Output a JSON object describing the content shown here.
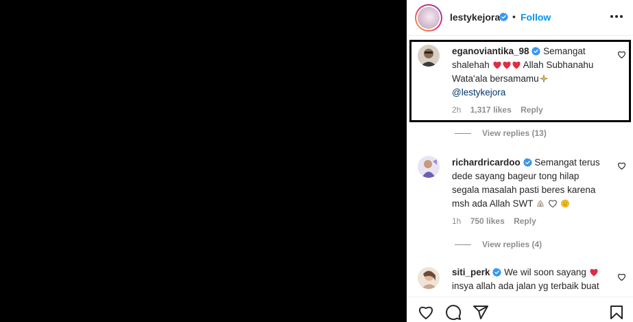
{
  "header": {
    "username": "lestykejora",
    "separator": "•",
    "follow_label": "Follow"
  },
  "comments": [
    {
      "username": "eganoviantika_98",
      "text_part1": " Semangat shalehah",
      "text_part2": " Allah Subhanahu Wata'ala bersamamu",
      "mention": "@lestykejora",
      "time": "2h",
      "likes": "1,317 likes",
      "reply_label": "Reply",
      "view_replies": "View replies (13)"
    },
    {
      "username": "richardricardoo",
      "text": " Semangat terus dede sayang bageur tong hilap segala masalah pasti beres karena msh ada Allah SWT ",
      "time": "1h",
      "likes": "750 likes",
      "reply_label": "Reply",
      "view_replies": "View replies (4)"
    },
    {
      "username": "siti_perk",
      "text": " We wil soon sayang",
      "text_part2": "insya allah ada jalan yg terbaik buat"
    }
  ],
  "colors": {
    "accent": "#0095f6",
    "verified": "#3897f0",
    "heart_red": "#ed4956",
    "text": "#262626",
    "muted": "#8e8e8e",
    "mention": "#00376b"
  },
  "icons": {
    "like": "heart-icon",
    "comment": "comment-icon",
    "share": "share-icon",
    "save": "bookmark-icon",
    "more": "more-options-icon"
  }
}
